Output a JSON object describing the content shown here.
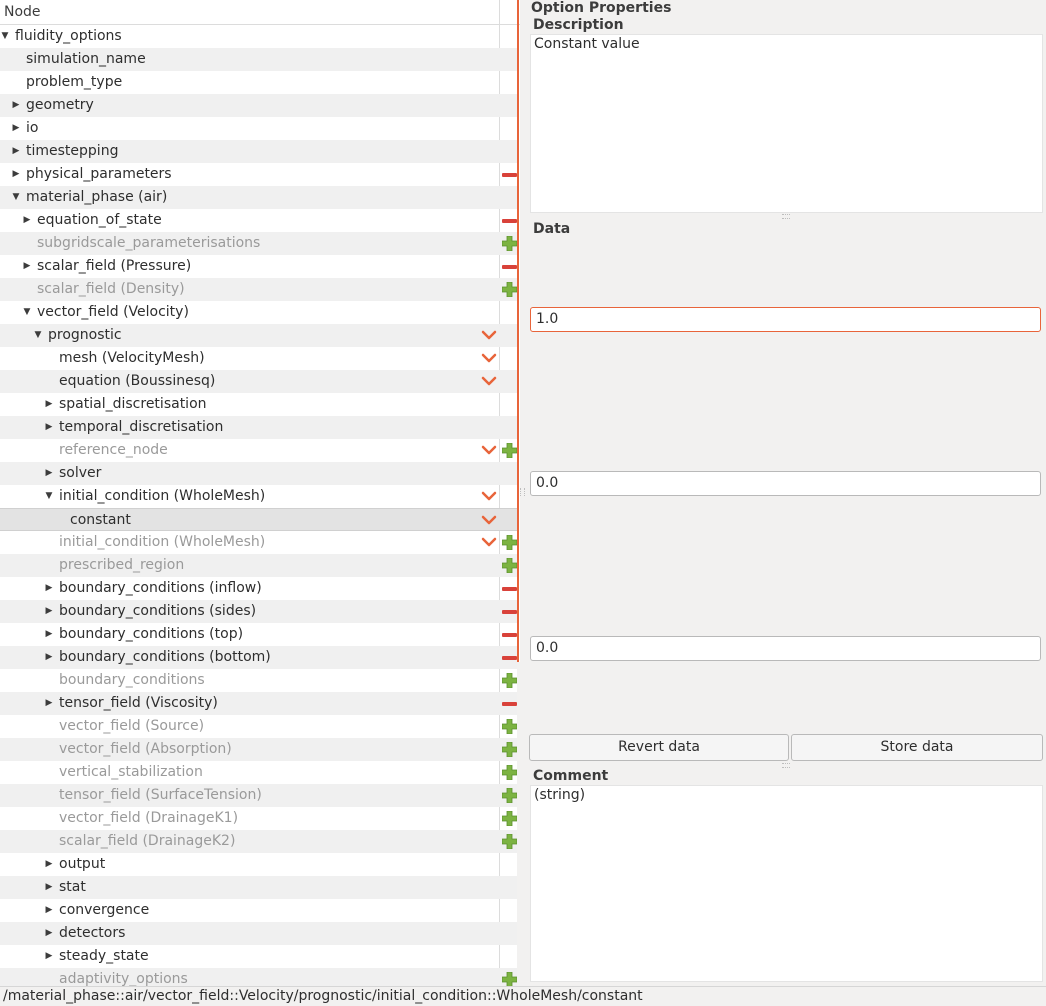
{
  "tree": {
    "header": "Node",
    "rows": [
      {
        "label": "fluidity_options",
        "depth": 0,
        "arrow": "down",
        "active": true,
        "chevron": false,
        "action": ""
      },
      {
        "label": "simulation_name",
        "depth": 1,
        "arrow": "",
        "active": true,
        "chevron": false,
        "action": ""
      },
      {
        "label": "problem_type",
        "depth": 1,
        "arrow": "",
        "active": true,
        "chevron": false,
        "action": ""
      },
      {
        "label": "geometry",
        "depth": 1,
        "arrow": "right",
        "active": true,
        "chevron": false,
        "action": ""
      },
      {
        "label": "io",
        "depth": 1,
        "arrow": "right",
        "active": true,
        "chevron": false,
        "action": ""
      },
      {
        "label": "timestepping",
        "depth": 1,
        "arrow": "right",
        "active": true,
        "chevron": false,
        "action": ""
      },
      {
        "label": "physical_parameters",
        "depth": 1,
        "arrow": "right",
        "active": true,
        "chevron": false,
        "action": "minus"
      },
      {
        "label": "material_phase (air)",
        "depth": 1,
        "arrow": "down",
        "active": true,
        "chevron": false,
        "action": ""
      },
      {
        "label": "equation_of_state",
        "depth": 2,
        "arrow": "right",
        "active": true,
        "chevron": false,
        "action": "minus"
      },
      {
        "label": "subgridscale_parameterisations",
        "depth": 2,
        "arrow": "",
        "active": false,
        "chevron": false,
        "action": "plus"
      },
      {
        "label": "scalar_field (Pressure)",
        "depth": 2,
        "arrow": "right",
        "active": true,
        "chevron": false,
        "action": "minus"
      },
      {
        "label": "scalar_field (Density)",
        "depth": 2,
        "arrow": "",
        "active": false,
        "chevron": false,
        "action": "plus"
      },
      {
        "label": "vector_field (Velocity)",
        "depth": 2,
        "arrow": "down",
        "active": true,
        "chevron": false,
        "action": ""
      },
      {
        "label": "prognostic",
        "depth": 3,
        "arrow": "down",
        "active": true,
        "chevron": true,
        "action": ""
      },
      {
        "label": "mesh (VelocityMesh)",
        "depth": 4,
        "arrow": "",
        "active": true,
        "chevron": true,
        "action": ""
      },
      {
        "label": "equation (Boussinesq)",
        "depth": 4,
        "arrow": "",
        "active": true,
        "chevron": true,
        "action": ""
      },
      {
        "label": "spatial_discretisation",
        "depth": 4,
        "arrow": "right",
        "active": true,
        "chevron": false,
        "action": ""
      },
      {
        "label": "temporal_discretisation",
        "depth": 4,
        "arrow": "right",
        "active": true,
        "chevron": false,
        "action": ""
      },
      {
        "label": "reference_node",
        "depth": 4,
        "arrow": "",
        "active": false,
        "chevron": true,
        "action": "plus"
      },
      {
        "label": "solver",
        "depth": 4,
        "arrow": "right",
        "active": true,
        "chevron": false,
        "action": ""
      },
      {
        "label": "initial_condition (WholeMesh)",
        "depth": 4,
        "arrow": "down",
        "active": true,
        "chevron": true,
        "action": ""
      },
      {
        "label": "constant",
        "depth": 5,
        "arrow": "",
        "active": true,
        "chevron": true,
        "action": "",
        "selected": true
      },
      {
        "label": "initial_condition (WholeMesh)",
        "depth": 4,
        "arrow": "",
        "active": false,
        "chevron": true,
        "action": "plus"
      },
      {
        "label": "prescribed_region",
        "depth": 4,
        "arrow": "",
        "active": false,
        "chevron": false,
        "action": "plus"
      },
      {
        "label": "boundary_conditions (inflow)",
        "depth": 4,
        "arrow": "right",
        "active": true,
        "chevron": false,
        "action": "minus"
      },
      {
        "label": "boundary_conditions (sides)",
        "depth": 4,
        "arrow": "right",
        "active": true,
        "chevron": false,
        "action": "minus"
      },
      {
        "label": "boundary_conditions (top)",
        "depth": 4,
        "arrow": "right",
        "active": true,
        "chevron": false,
        "action": "minus"
      },
      {
        "label": "boundary_conditions (bottom)",
        "depth": 4,
        "arrow": "right",
        "active": true,
        "chevron": false,
        "action": "minus"
      },
      {
        "label": "boundary_conditions",
        "depth": 4,
        "arrow": "",
        "active": false,
        "chevron": false,
        "action": "plus"
      },
      {
        "label": "tensor_field (Viscosity)",
        "depth": 4,
        "arrow": "right",
        "active": true,
        "chevron": false,
        "action": "minus"
      },
      {
        "label": "vector_field (Source)",
        "depth": 4,
        "arrow": "",
        "active": false,
        "chevron": false,
        "action": "plus"
      },
      {
        "label": "vector_field (Absorption)",
        "depth": 4,
        "arrow": "",
        "active": false,
        "chevron": false,
        "action": "plus"
      },
      {
        "label": "vertical_stabilization",
        "depth": 4,
        "arrow": "",
        "active": false,
        "chevron": false,
        "action": "plus"
      },
      {
        "label": "tensor_field (SurfaceTension)",
        "depth": 4,
        "arrow": "",
        "active": false,
        "chevron": false,
        "action": "plus"
      },
      {
        "label": "vector_field (DrainageK1)",
        "depth": 4,
        "arrow": "",
        "active": false,
        "chevron": false,
        "action": "plus"
      },
      {
        "label": "scalar_field (DrainageK2)",
        "depth": 4,
        "arrow": "",
        "active": false,
        "chevron": false,
        "action": "plus"
      },
      {
        "label": "output",
        "depth": 4,
        "arrow": "right",
        "active": true,
        "chevron": false,
        "action": ""
      },
      {
        "label": "stat",
        "depth": 4,
        "arrow": "right",
        "active": true,
        "chevron": false,
        "action": ""
      },
      {
        "label": "convergence",
        "depth": 4,
        "arrow": "right",
        "active": true,
        "chevron": false,
        "action": ""
      },
      {
        "label": "detectors",
        "depth": 4,
        "arrow": "right",
        "active": true,
        "chevron": false,
        "action": ""
      },
      {
        "label": "steady_state",
        "depth": 4,
        "arrow": "right",
        "active": true,
        "chevron": false,
        "action": ""
      },
      {
        "label": "adaptivity_options",
        "depth": 4,
        "arrow": "",
        "active": false,
        "chevron": false,
        "action": "plus"
      }
    ]
  },
  "properties": {
    "title": "Option Properties",
    "description_label": "Description",
    "description_text": "Constant value",
    "data_label": "Data",
    "data_values": [
      "1.0",
      "0.0",
      "0.0"
    ],
    "revert_label": "Revert data",
    "store_label": "Store data",
    "comment_label": "Comment",
    "comment_text": "(string)"
  },
  "status_path": "/material_phase::air/vector_field::Velocity/prognostic/initial_condition::WholeMesh/constant",
  "colors": {
    "accent": "#e8643a",
    "minus": "#d9423a",
    "plus": "#7cb342",
    "chevron": "#e8643a"
  }
}
